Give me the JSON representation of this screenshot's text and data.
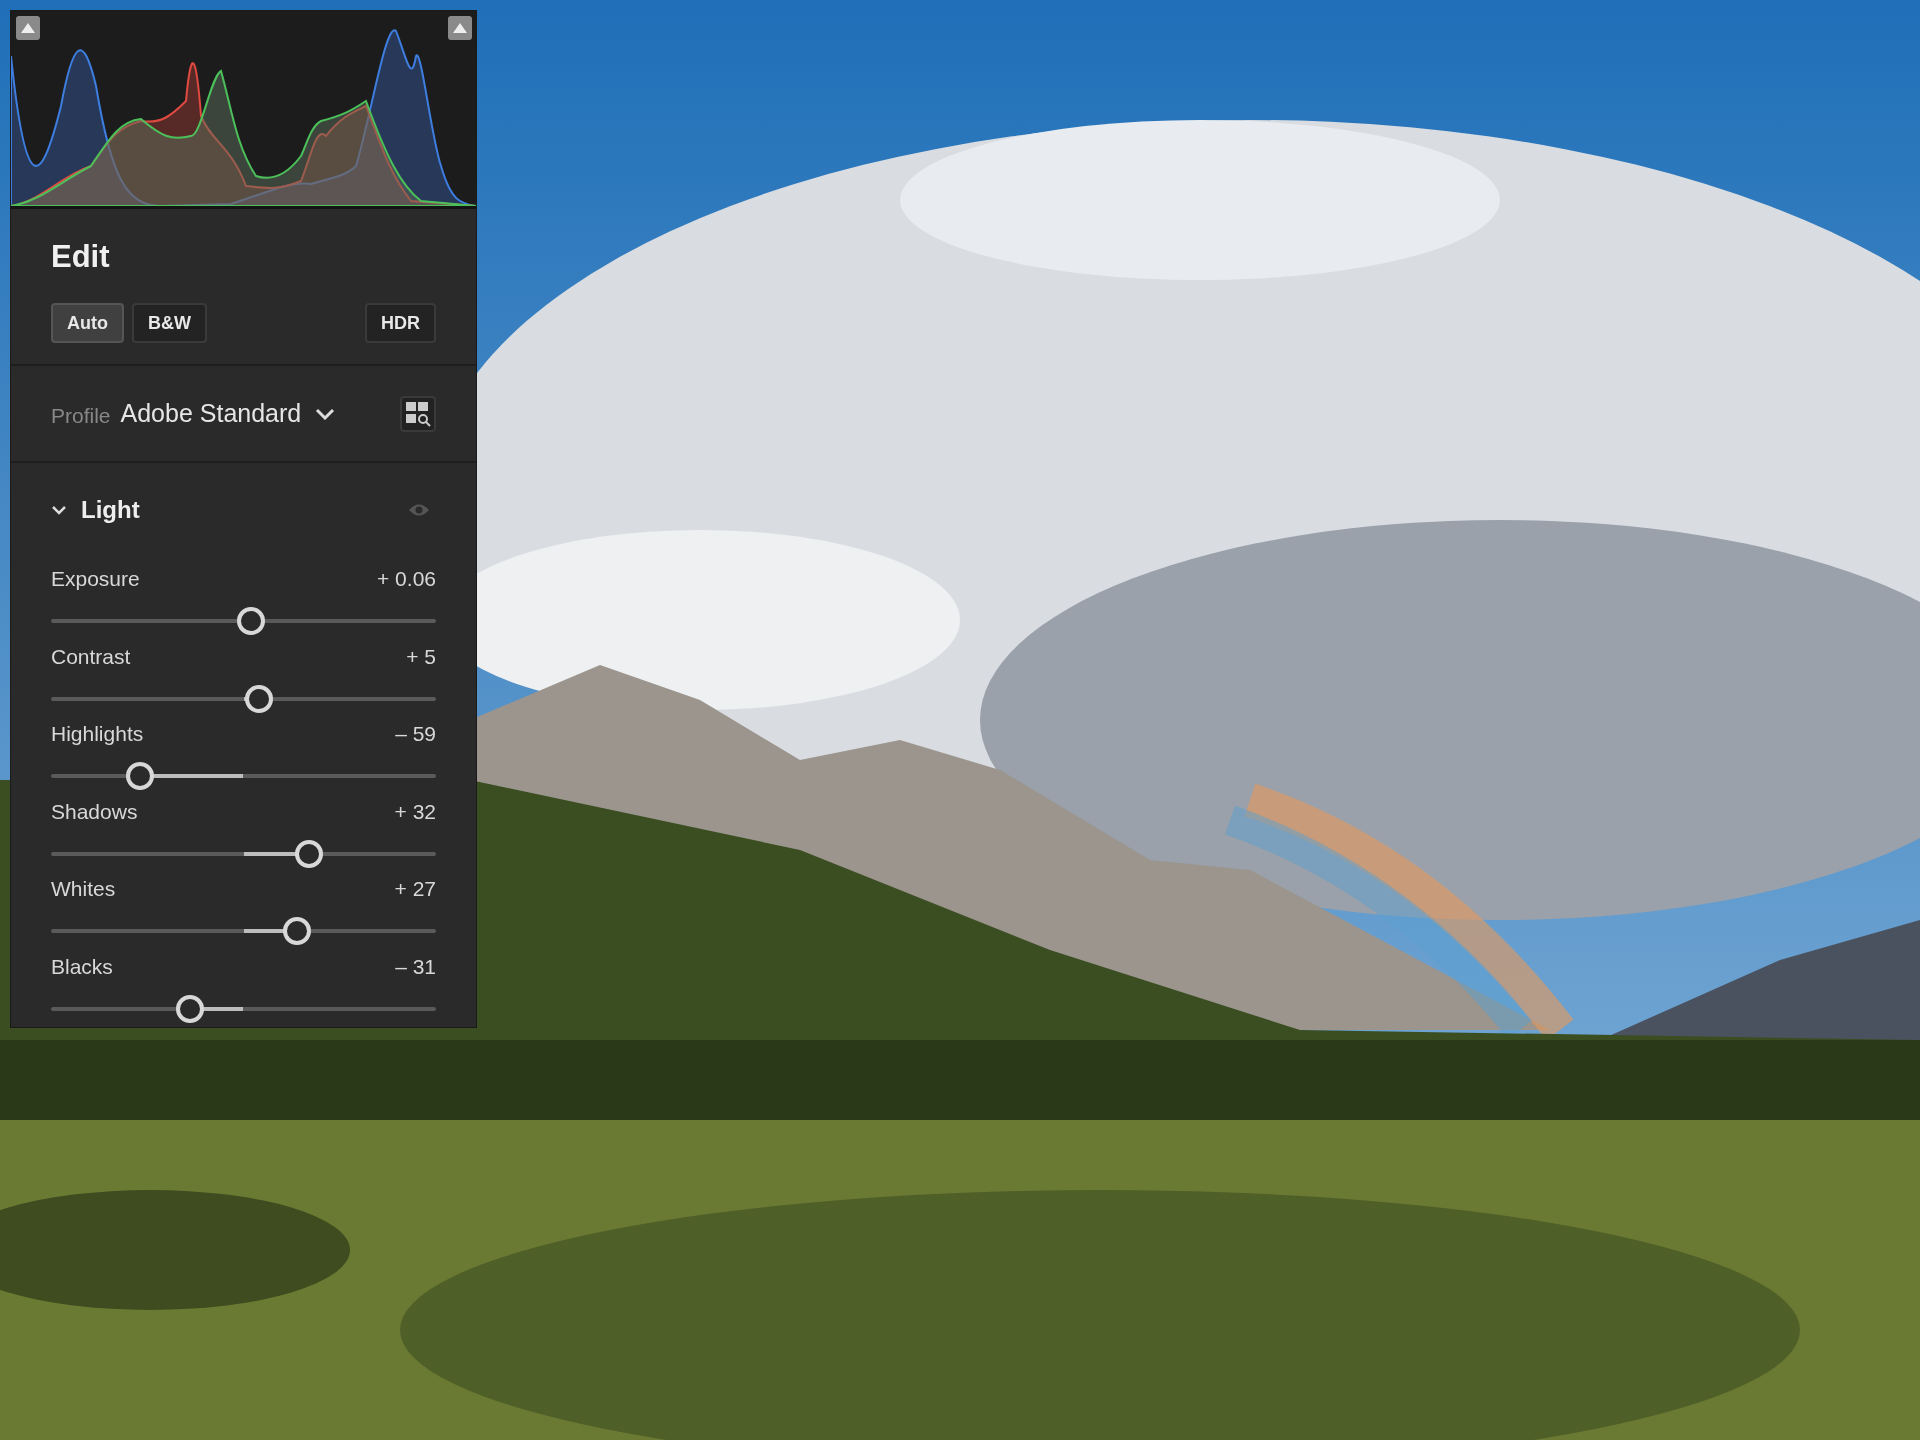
{
  "edit": {
    "title": "Edit",
    "buttons": [
      {
        "label": "Auto",
        "selected": true
      },
      {
        "label": "B&W",
        "selected": false
      },
      {
        "label": "HDR",
        "selected": false
      }
    ]
  },
  "profile": {
    "label": "Profile",
    "value": "Adobe Standard"
  },
  "light": {
    "title": "Light",
    "expanded": true,
    "sliders": [
      {
        "name": "Exposure",
        "reading": "+ 0.06",
        "level": 0.52
      },
      {
        "name": "Contrast",
        "reading": "+ 5",
        "level": 0.54
      },
      {
        "name": "Highlights",
        "reading": "– 59",
        "level": 0.23
      },
      {
        "name": "Shadows",
        "reading": "+ 32",
        "level": 0.67
      },
      {
        "name": "Whites",
        "reading": "+ 27",
        "level": 0.64
      },
      {
        "name": "Blacks",
        "reading": "– 31",
        "level": 0.36
      }
    ]
  }
}
